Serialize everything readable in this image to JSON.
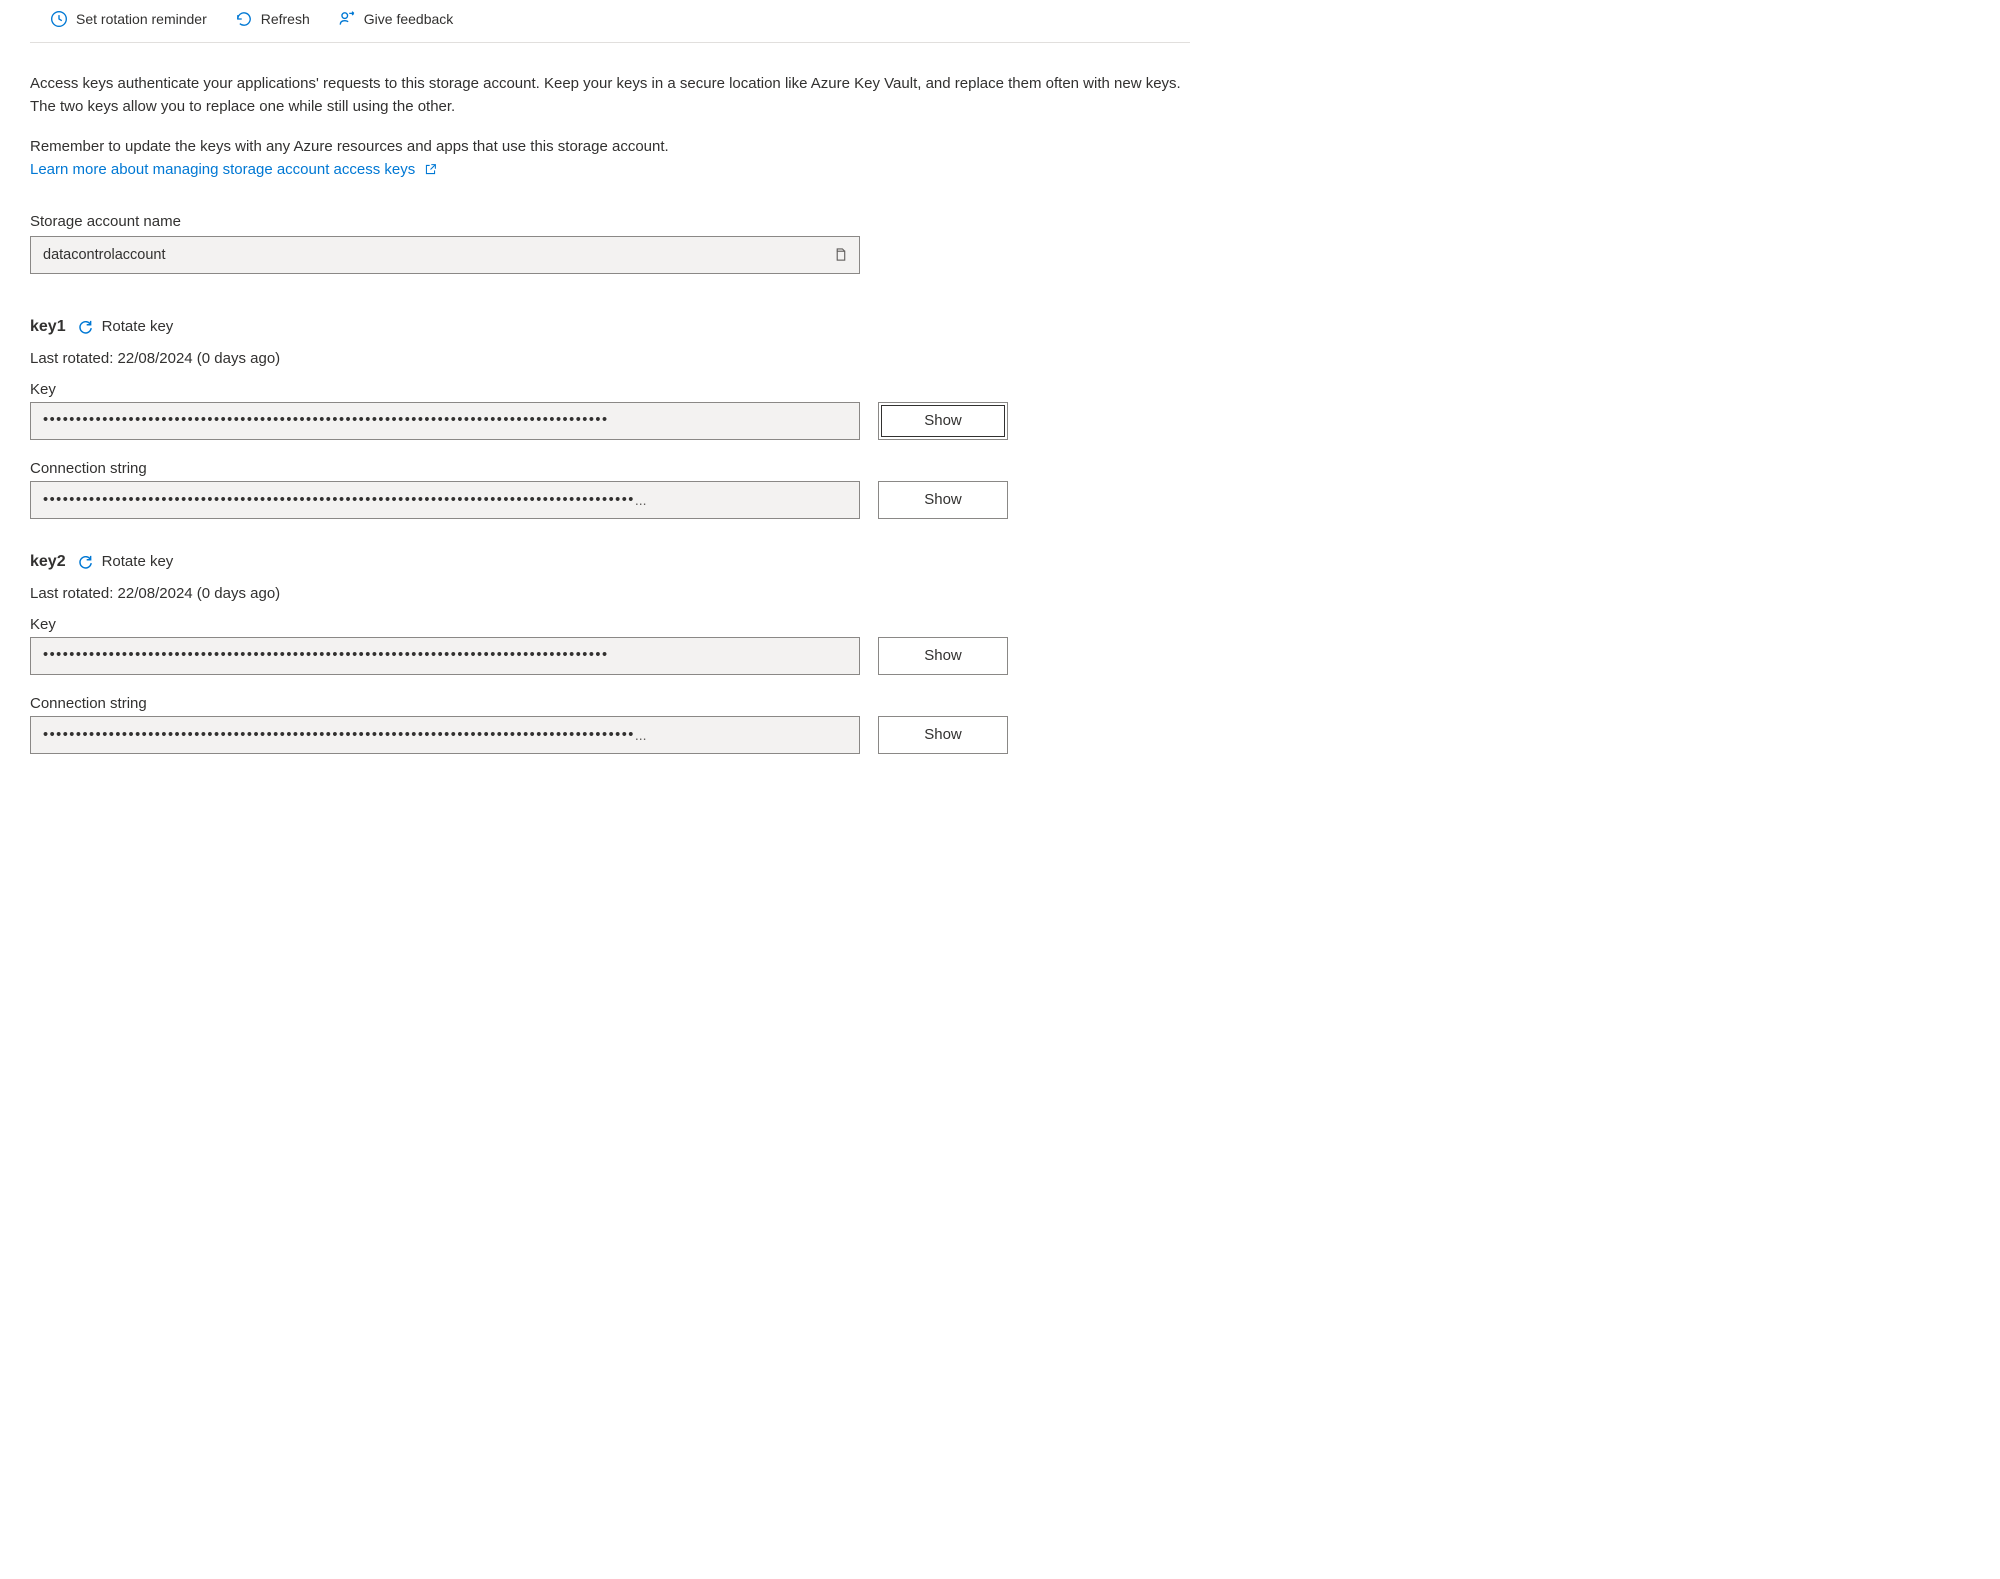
{
  "toolbar": {
    "set_reminder_label": "Set rotation reminder",
    "refresh_label": "Refresh",
    "feedback_label": "Give feedback"
  },
  "intro": {
    "paragraph": "Access keys authenticate your applications' requests to this storage account. Keep your keys in a secure location like Azure Key Vault, and replace them often with new keys. The two keys allow you to replace one while still using the other.",
    "reminder": "Remember to update the keys with any Azure resources and apps that use this storage account.",
    "learn_more_label": "Learn more about managing storage account access keys"
  },
  "storage_account": {
    "label": "Storage account name",
    "value": "datacontrolaccount"
  },
  "keys": [
    {
      "name": "key1",
      "rotate_label": "Rotate key",
      "last_rotated": "Last rotated: 22/08/2024 (0 days ago)",
      "key_label": "Key",
      "key_masked": "••••••••••••••••••••••••••••••••••••••••••••••••••••••••••••••••••••••••••••••••••••••",
      "conn_label": "Connection string",
      "conn_masked": "••••••••••••••••••••••••••••••••••••••••••••••••••••••••••••••••••••••••••••••••••••••••••",
      "show_label": "Show"
    },
    {
      "name": "key2",
      "rotate_label": "Rotate key",
      "last_rotated": "Last rotated: 22/08/2024 (0 days ago)",
      "key_label": "Key",
      "key_masked": "••••••••••••••••••••••••••••••••••••••••••••••••••••••••••••••••••••••••••••••••••••••",
      "conn_label": "Connection string",
      "conn_masked": "••••••••••••••••••••••••••••••••••••••••••••••••••••••••••••••••••••••••••••••••••••••••••",
      "show_label": "Show"
    }
  ]
}
